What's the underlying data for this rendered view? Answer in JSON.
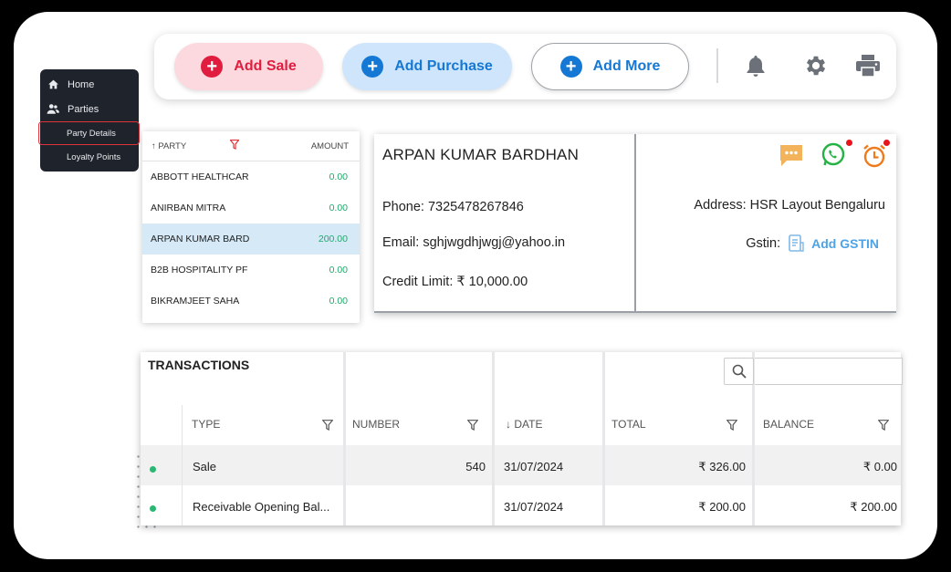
{
  "sidebar": {
    "items": [
      {
        "label": "Home",
        "icon": "home-icon"
      },
      {
        "label": "Parties",
        "icon": "users-icon"
      }
    ],
    "sub_items": [
      {
        "label": "Party Details",
        "active": true
      },
      {
        "label": "Loyalty Points",
        "active": false
      }
    ]
  },
  "toolbar": {
    "add_sale": "Add Sale",
    "add_purchase": "Add Purchase",
    "add_more": "Add More",
    "icons": [
      "bell-icon",
      "gear-icon",
      "printer-icon"
    ]
  },
  "party_list": {
    "col_party": "PARTY",
    "col_amount": "AMOUNT",
    "rows": [
      {
        "name": "ABBOTT HEALTHCAR",
        "amount": "0.00"
      },
      {
        "name": "ANIRBAN MITRA",
        "amount": "0.00"
      },
      {
        "name": "ARPAN KUMAR BARD",
        "amount": "200.00",
        "selected": true
      },
      {
        "name": "B2B HOSPITALITY PF",
        "amount": "0.00"
      },
      {
        "name": "BIKRAMJEET SAHA",
        "amount": "0.00"
      }
    ]
  },
  "party_detail": {
    "name": "ARPAN KUMAR BARDHAN",
    "phone": "Phone: 7325478267846",
    "email": "Email: sghjwgdhjwgj@yahoo.in",
    "credit_limit": "Credit Limit: ₹ 10,000.00",
    "address": "Address: HSR Layout Bengaluru",
    "gstin_label": "Gstin:",
    "add_gstin": "Add GSTIN"
  },
  "transactions": {
    "title": "TRANSACTIONS",
    "search_placeholder": "",
    "columns": [
      "TYPE",
      "NUMBER",
      "DATE",
      "TOTAL",
      "BALANCE"
    ],
    "rows": [
      {
        "type": "Sale",
        "number": "540",
        "date": "31/07/2024",
        "total": "₹ 326.00",
        "balance": "₹ 0.00"
      },
      {
        "type": "Receivable Opening Bal...",
        "number": "",
        "date": "31/07/2024",
        "total": "₹ 200.00",
        "balance": "₹ 200.00"
      }
    ]
  },
  "colors": {
    "sale": "#e11d3f",
    "purchase": "#1478d4",
    "amount_green": "#1daa6a",
    "selected_row": "#d5e9f7",
    "sidebar_bg": "#1f232b"
  }
}
